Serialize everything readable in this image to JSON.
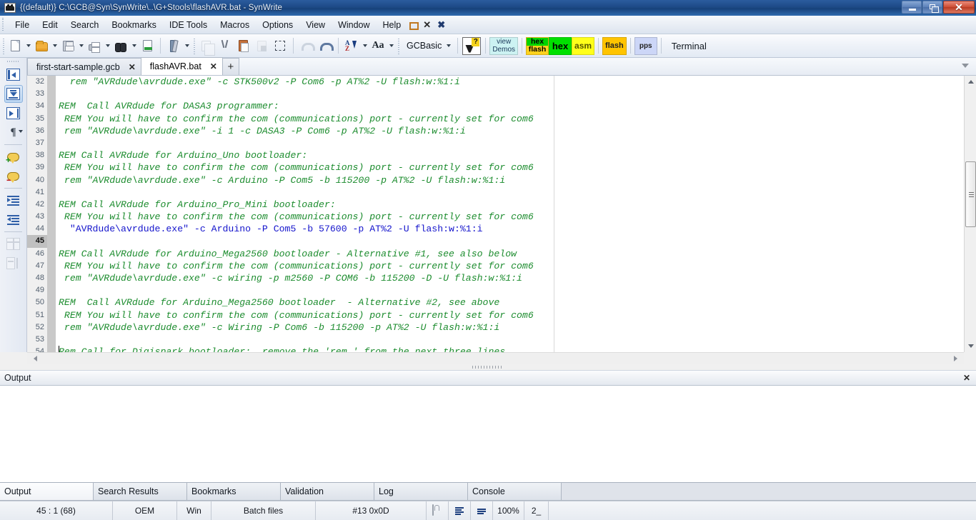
{
  "window": {
    "title": "{(default)} C:\\GCB@Syn\\SynWrite\\..\\G+Stools\\flashAVR.bat - SynWrite",
    "icon": "synwrite-app-icon",
    "controls": {
      "minimize": "–",
      "restore": "❐",
      "close": "✕"
    }
  },
  "menubar": {
    "items": [
      {
        "label": "File"
      },
      {
        "label": "Edit"
      },
      {
        "label": "Search"
      },
      {
        "label": "Bookmarks"
      },
      {
        "label": "IDE Tools"
      },
      {
        "label": "Macros"
      },
      {
        "label": "Options"
      },
      {
        "label": "View"
      },
      {
        "label": "Window"
      },
      {
        "label": "Help"
      }
    ],
    "mdi": {
      "restore": "restore-document",
      "close": "close-document",
      "close_all": "close-all-documents"
    }
  },
  "toolbar": {
    "buttons": [
      {
        "name": "new-file-icon",
        "tip": "New file",
        "arrow": true
      },
      {
        "name": "open-file-icon",
        "tip": "Open file",
        "arrow": true
      },
      {
        "name": "save-file-icon",
        "tip": "Save",
        "arrow": true
      },
      {
        "name": "print-icon",
        "tip": "Print",
        "arrow": true
      },
      {
        "name": "find-icon",
        "tip": "Find",
        "arrow": true
      },
      {
        "name": "export-icon",
        "tip": "Export"
      },
      {
        "name": "tools-icon",
        "tip": "Tools",
        "arrow": true
      },
      {
        "name": "copy-icon",
        "tip": "Copy"
      },
      {
        "name": "cut-icon",
        "tip": "Cut"
      },
      {
        "name": "paste-icon",
        "tip": "Paste"
      },
      {
        "name": "delete-icon",
        "tip": "Delete"
      },
      {
        "name": "select-all-icon",
        "tip": "Select all"
      },
      {
        "name": "undo-icon",
        "tip": "Undo"
      },
      {
        "name": "redo-icon",
        "tip": "Redo"
      },
      {
        "name": "sort-icon",
        "tip": "Sort",
        "arrow": true
      },
      {
        "name": "font-icon",
        "tip": "Font",
        "arrow": true
      }
    ],
    "lexer_combo": {
      "value": "GCBasic"
    },
    "help_button": {
      "name": "help-icon"
    },
    "action_buttons": [
      {
        "name": "view-demos-button",
        "lines": [
          "view",
          "Demos"
        ],
        "color": "#ccf2f2"
      },
      {
        "name": "hex-flash-button",
        "lines": [
          "hex",
          "flash"
        ],
        "color_top": "#00d400",
        "color_bottom": "#ffd21e"
      },
      {
        "name": "hex-button",
        "lines": [
          "hex"
        ],
        "color": "#00e000"
      },
      {
        "name": "asm-button",
        "lines": [
          "asm"
        ],
        "color": "#ffff1a"
      },
      {
        "name": "flash-button",
        "lines": [
          "flash"
        ],
        "color": "#ffc400"
      },
      {
        "name": "pps-button",
        "lines": [
          "pps"
        ],
        "color": "#ccd6f7"
      },
      {
        "name": "terminal-button",
        "label": "Terminal"
      }
    ]
  },
  "sidebar": {
    "buttons": [
      {
        "name": "collapse-left-icon",
        "active": false,
        "enabled": true
      },
      {
        "name": "fold-all-icon",
        "active": true,
        "enabled": true
      },
      {
        "name": "expand-right-icon",
        "active": false,
        "enabled": true
      },
      {
        "name": "show-nonprinting-icon",
        "active": false,
        "enabled": true,
        "arrow": true
      },
      {
        "name": "add-comment-icon",
        "active": false,
        "enabled": true
      },
      {
        "name": "remove-comment-icon",
        "active": false,
        "enabled": true
      },
      {
        "name": "indent-icon",
        "active": false,
        "enabled": true
      },
      {
        "name": "outdent-icon",
        "active": false,
        "enabled": true
      },
      {
        "name": "table-insert-icon",
        "active": false,
        "enabled": false
      },
      {
        "name": "table-resize-icon",
        "active": false,
        "enabled": false
      }
    ]
  },
  "tabs": {
    "items": [
      {
        "label": "first-start-sample.gcb",
        "active": false,
        "close": "✕"
      },
      {
        "label": "flashAVR.bat",
        "active": true,
        "close": "✕"
      }
    ],
    "new_tab": "+",
    "dropdown": "tab-list-dropdown"
  },
  "editor": {
    "first_line": 32,
    "current_line": 45,
    "lines": [
      {
        "n": 32,
        "text": "  rem \"AVRdude\\avrdude.exe\" -c STK500v2 -P Com6 -p AT%2 -U flash:w:%1:i",
        "style": "comment"
      },
      {
        "n": 33,
        "text": "",
        "style": "comment"
      },
      {
        "n": 34,
        "text": "REM  Call AVRdude for DASA3 programmer:",
        "style": "comment"
      },
      {
        "n": 35,
        "text": " REM You will have to confirm the com (communications) port - currently set for com6",
        "style": "comment"
      },
      {
        "n": 36,
        "text": " rem \"AVRdude\\avrdude.exe\" -i 1 -c DASA3 -P Com6 -p AT%2 -U flash:w:%1:i",
        "style": "comment"
      },
      {
        "n": 37,
        "text": "",
        "style": "comment"
      },
      {
        "n": 38,
        "text": "REM Call AVRdude for Arduino_Uno bootloader:",
        "style": "comment"
      },
      {
        "n": 39,
        "text": " REM You will have to confirm the com (communications) port - currently set for com6",
        "style": "comment"
      },
      {
        "n": 40,
        "text": " rem \"AVRdude\\avrdude.exe\" -c Arduino -P Com5 -b 115200 -p AT%2 -U flash:w:%1:i",
        "style": "comment"
      },
      {
        "n": 41,
        "text": "",
        "style": "comment"
      },
      {
        "n": 42,
        "text": "REM Call AVRdude for Arduino_Pro_Mini bootloader:",
        "style": "comment"
      },
      {
        "n": 43,
        "text": " REM You will have to confirm the com (communications) port - currently set for com6",
        "style": "comment"
      },
      {
        "n": 44,
        "text": "  \"AVRdude\\avrdude.exe\" -c Arduino -P Com5 -b 57600 -p AT%2 -U flash:w:%1:i",
        "style": "code"
      },
      {
        "n": 45,
        "text": "",
        "style": "code"
      },
      {
        "n": 46,
        "text": "REM Call AVRdude for Arduino_Mega2560 bootloader - Alternative #1, see also below",
        "style": "comment"
      },
      {
        "n": 47,
        "text": " REM You will have to confirm the com (communications) port - currently set for com6",
        "style": "comment"
      },
      {
        "n": 48,
        "text": " rem \"AVRdude\\avrdude.exe\" -c wiring -p m2560 -P COM6 -b 115200 -D -U flash:w:%1:i",
        "style": "comment"
      },
      {
        "n": 49,
        "text": "",
        "style": "comment"
      },
      {
        "n": 50,
        "text": "REM  Call AVRdude for Arduino_Mega2560 bootloader  - Alternative #2, see above",
        "style": "comment"
      },
      {
        "n": 51,
        "text": " REM You will have to confirm the com (communications) port - currently set for com6",
        "style": "comment"
      },
      {
        "n": 52,
        "text": " rem \"AVRdude\\avrdude.exe\" -c Wiring -P Com6 -b 115200 -p AT%2 -U flash:w:%1:i",
        "style": "comment"
      },
      {
        "n": 53,
        "text": "",
        "style": "comment"
      },
      {
        "n": 54,
        "text": "Rem Call for Digispark bootloader:  remove the 'rem ' from the next three lines",
        "style": "comment"
      }
    ],
    "colors": {
      "comment": "#1c8c2e",
      "code": "#1414cc",
      "current_line_gutter": "#c0c0c0"
    }
  },
  "output_panel": {
    "title": "Output",
    "close": "✕",
    "content": ""
  },
  "bottom_tabs": {
    "items": [
      {
        "label": "Output",
        "active": true
      },
      {
        "label": "Search Results",
        "active": false
      },
      {
        "label": "Bookmarks",
        "active": false
      },
      {
        "label": "Validation",
        "active": false
      },
      {
        "label": "Log",
        "active": false
      },
      {
        "label": "Console",
        "active": false
      }
    ]
  },
  "statusbar": {
    "caret": "45 : 1 (68)",
    "encoding": "OEM",
    "line_ends": "Win",
    "lexer": "Batch files",
    "char_code": "#13 0x0D",
    "lock_icon": "read-only-lock-icon",
    "wrap_icon": "word-wrap-icon",
    "unprint_icon": "show-unprinted-icon",
    "zoom": "100%",
    "tab_size": "2_"
  }
}
